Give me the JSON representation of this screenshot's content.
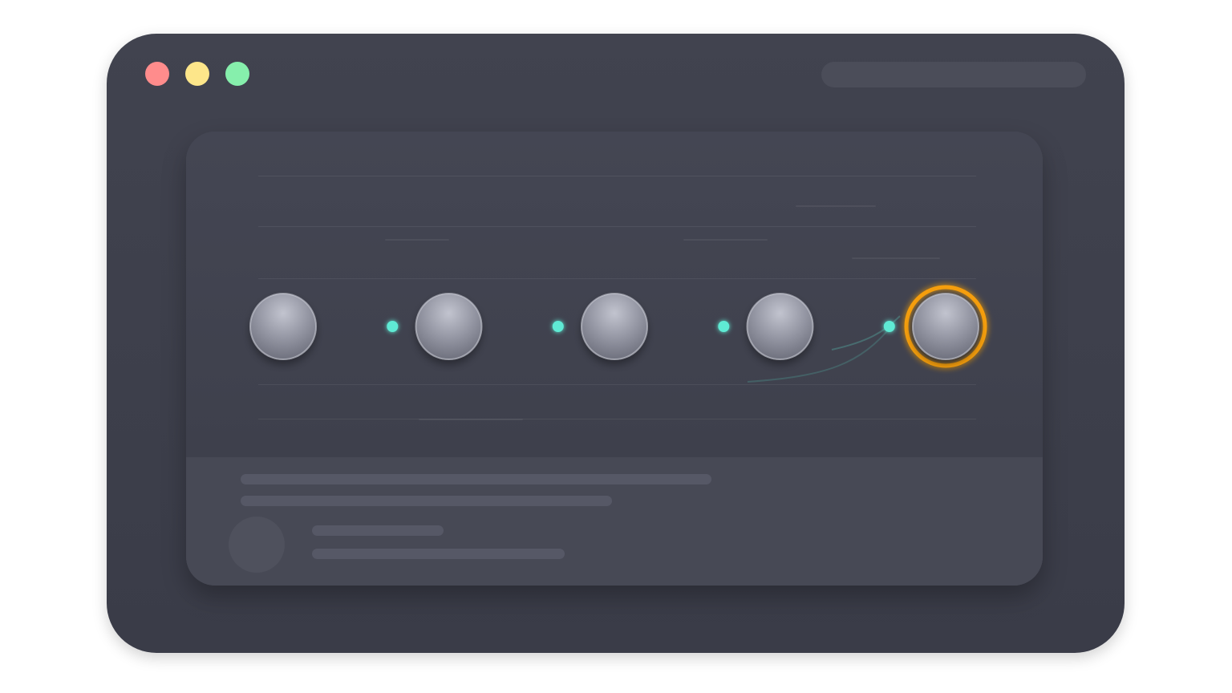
{
  "window": {
    "controls": [
      {
        "name": "close",
        "color": "#ff8c8c"
      },
      {
        "name": "minimize",
        "color": "#fde68a"
      },
      {
        "name": "maximize",
        "color": "#86efac"
      }
    ],
    "address_bar": {
      "value": ""
    }
  },
  "workflow": {
    "steps_total": 5,
    "active_step": 5,
    "track_color": "#5eead4",
    "node_color": "#8f919e",
    "active_ring_color": "#f59e0b"
  },
  "footer": {
    "text_lines": 2,
    "meta_lines": 2
  }
}
